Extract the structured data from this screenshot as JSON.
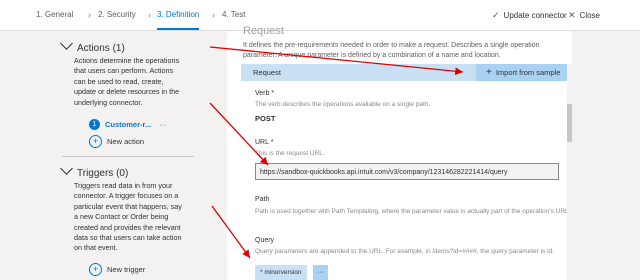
{
  "steps": [
    {
      "label": "1. General"
    },
    {
      "label": "2. Security"
    },
    {
      "label": "3. Definition"
    },
    {
      "label": "4. Test"
    }
  ],
  "top_actions": {
    "update_label": "Update connector",
    "close_label": "Close"
  },
  "sidebar": {
    "actions": {
      "title": "Actions (1)",
      "description": "Actions determine the operations that users can perform. Actions can be used to read, create, update or delete resources in the underlying connector.",
      "items": [
        {
          "number": "1",
          "label": "Customer-r...",
          "menu": "···"
        }
      ],
      "add_label": "New action"
    },
    "triggers": {
      "title": "Triggers (0)",
      "description": "Triggers read data in from your connector. A trigger focuses on a particular event that happens, say a new Contact or Order being created and provides the relevant data so that users can take action on that event.",
      "add_label": "New trigger"
    }
  },
  "request_panel": {
    "title": "Request",
    "description": "It defines the pre-requirements needed in order to make a request. Describes a single operation parameter. A unique parameter is defined by a combination of a name and location.",
    "bar_label": "Request",
    "import_label": "Import from sample",
    "verb": {
      "label": "Verb *",
      "help": "The verb describes the operations available on a single path.",
      "value": "POST"
    },
    "url": {
      "label": "URL *",
      "help": "This is the request URL.",
      "value": "https://sandbox-quickbooks.api.intuit.com/v3/company/123146282221414/query"
    },
    "path": {
      "label": "Path",
      "help": "Path is used together with Path Templating, where the parameter value is actually part of the operation's URL."
    },
    "query": {
      "label": "Query",
      "help": "Query parameters are appended to the URL. For example, in /items?id=####, the query parameter is id.",
      "tag": "* minorversion",
      "tag_menu": "···"
    }
  },
  "colors": {
    "accent": "#0078d4",
    "arrow": "#e00000",
    "panel_bg": "#f3f2f1",
    "bar_bg": "#c7e0f4"
  }
}
